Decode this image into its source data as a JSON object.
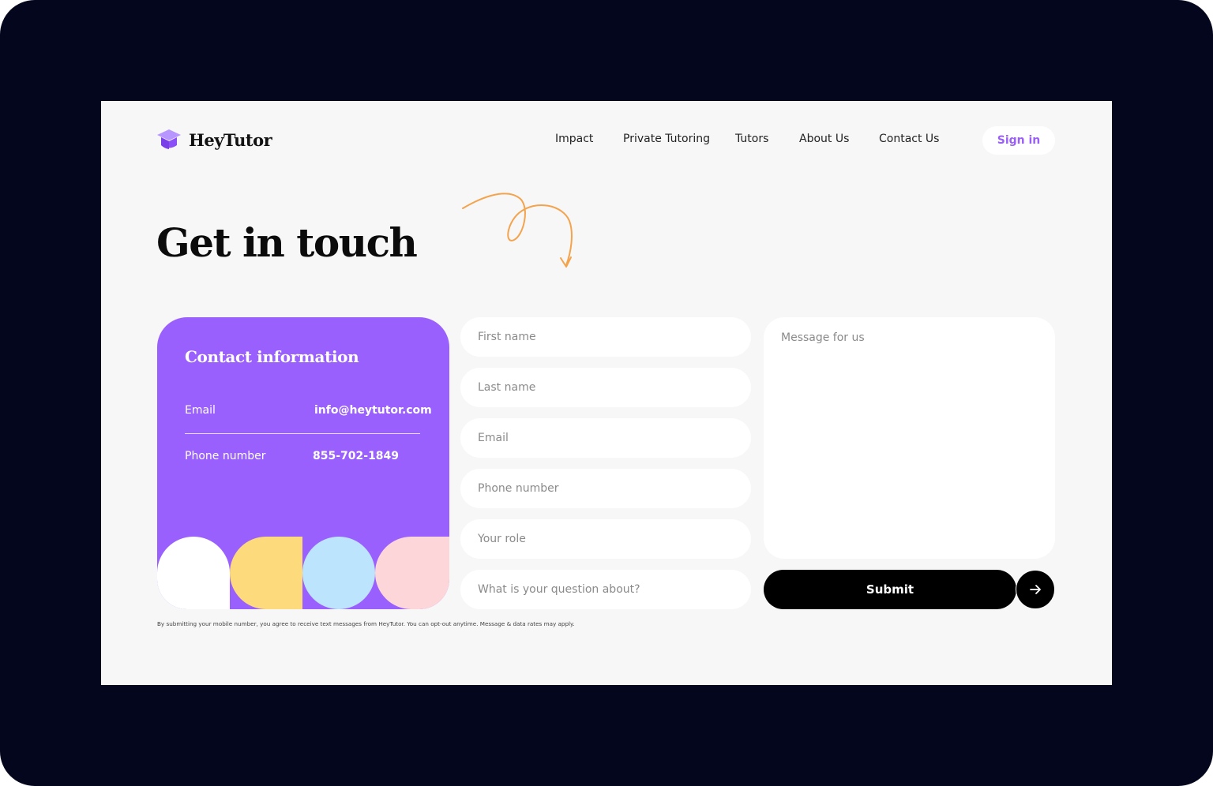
{
  "brand": {
    "name": "HeyTutor",
    "icon": "graduation-cap-icon",
    "color": "#9a60fd"
  },
  "nav": {
    "items": [
      "Impact",
      "Private Tutoring",
      "Tutors",
      "About Us",
      "Contact Us"
    ],
    "signin_label": "Sign in"
  },
  "hero": {
    "title": "Get in touch"
  },
  "contact_card": {
    "title": "Contact information",
    "email_label": "Email",
    "email_value": "info@heytutor.com",
    "phone_label": "Phone number",
    "phone_value": "855-702-1849",
    "shape_colors": [
      "#ffffff",
      "#fdda7c",
      "#bde4fd",
      "#fdd6d9"
    ]
  },
  "form": {
    "first_name_placeholder": "First name",
    "last_name_placeholder": "Last name",
    "email_placeholder": "Email",
    "phone_placeholder": "Phone number",
    "role_placeholder": "Your role",
    "question_placeholder": "What is your question about?",
    "message_placeholder": "Message for us",
    "submit_label": "Submit",
    "submit_icon": "arrow-right-icon"
  },
  "disclaimer": "By submitting your mobile number, you agree to receive text messages from HeyTutor. You can opt-out anytime. Message & data rates may apply.",
  "colors": {
    "frame": "#03061c",
    "page": "#f7f7f7",
    "accent": "#9a60fd",
    "squiggle": "#f4a34c"
  }
}
